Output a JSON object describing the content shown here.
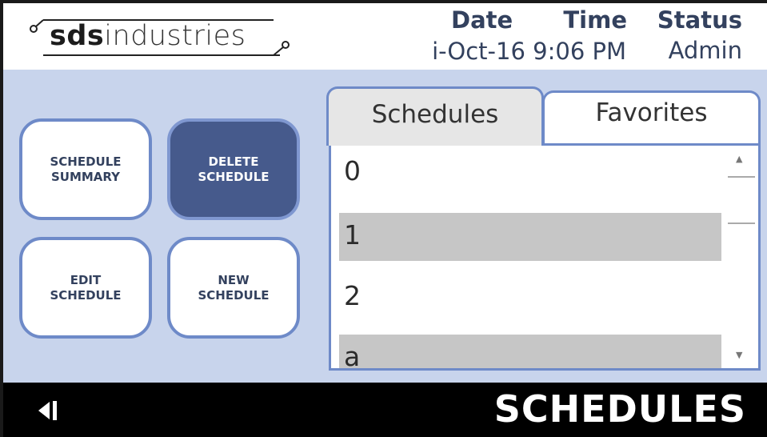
{
  "header": {
    "logo": {
      "bold": "sds",
      "light": "industries"
    },
    "date_label": "Date",
    "time_label": "Time",
    "status_label": "Status",
    "date_value": "i-Oct-16",
    "time_value": "9:06 PM",
    "status_value": "Admin"
  },
  "buttons": {
    "schedule_summary": [
      "SCHEDULE",
      "SUMMARY"
    ],
    "delete_schedule": [
      "DELETE",
      "SCHEDULE"
    ],
    "edit_schedule": [
      "EDIT",
      "SCHEDULE"
    ],
    "new_schedule": [
      "NEW",
      "SCHEDULE"
    ]
  },
  "tabs": {
    "schedules": "Schedules",
    "favorites": "Favorites",
    "selected": "schedules"
  },
  "list": {
    "items": [
      "0",
      "1",
      "2",
      "a"
    ]
  },
  "footer": {
    "title": "SCHEDULES"
  },
  "colors": {
    "background": "#c8d4ec",
    "accent_border": "#6e8ac8",
    "active_button": "#465a8c",
    "text_dark": "#33415e",
    "row_alt": "#c6c6c6",
    "footer": "#000000"
  },
  "icons": {
    "back": "back-arrow-icon",
    "scroll_up": "scroll-up-icon",
    "scroll_down": "scroll-down-icon"
  }
}
